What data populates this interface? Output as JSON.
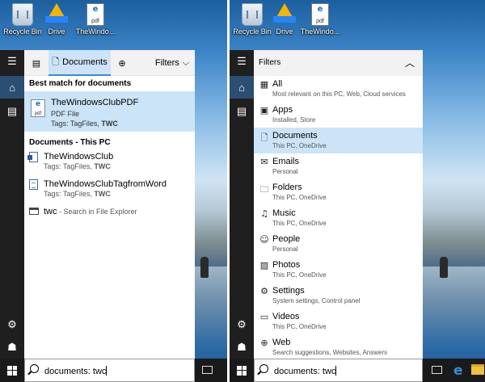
{
  "desktop": {
    "icons": [
      {
        "label": "Recycle Bin",
        "icon": "recycle-bin-icon"
      },
      {
        "label": "Drive",
        "icon": "google-drive-icon"
      },
      {
        "label": "TheWindo...",
        "icon": "pdf-file-icon",
        "glyph": "e",
        "tag": "pdf"
      }
    ]
  },
  "left": {
    "scopes": {
      "documents": "Documents",
      "filters": "Filters"
    },
    "best_match": {
      "heading": "Best match for documents",
      "title": "TheWindowsClubPDF",
      "type": "PDF File",
      "tags_prefix": "Tags: TagFiles, ",
      "tags_bold": "TWC",
      "icon_glyph": "e",
      "icon_tag": "pdf"
    },
    "documents_section": {
      "heading": "Documents - This PC",
      "items": [
        {
          "title": "TheWindowsClub",
          "tags_prefix": "Tags: TagFiles, ",
          "tags_bold": "TWC"
        },
        {
          "title": "TheWindowsClubTagfromWord",
          "tags_prefix": "Tags: TagFiles, ",
          "tags_bold": "TWC"
        }
      ]
    },
    "explorer_search": {
      "term": "twc",
      "suffix": " - Search in File Explorer"
    }
  },
  "right": {
    "filters_heading": "Filters",
    "filters": [
      {
        "title": "All",
        "sub": "Most relevant on this PC, Web, Cloud services",
        "icon": "grid-icon",
        "glyph": "▦"
      },
      {
        "title": "Apps",
        "sub": "Installed, Store",
        "icon": "apps-icon",
        "glyph": "▣"
      },
      {
        "title": "Documents",
        "sub": "This PC, OneDrive",
        "icon": "document-icon",
        "glyph": "🗋",
        "active": true
      },
      {
        "title": "Emails",
        "sub": "Personal",
        "icon": "mail-icon",
        "glyph": "✉"
      },
      {
        "title": "Folders",
        "sub": "This PC, OneDrive",
        "icon": "folder-icon",
        "glyph": "🗀"
      },
      {
        "title": "Music",
        "sub": "This PC, OneDrive",
        "icon": "music-icon",
        "glyph": "♫"
      },
      {
        "title": "People",
        "sub": "Personal",
        "icon": "people-icon",
        "glyph": "☺"
      },
      {
        "title": "Photos",
        "sub": "This PC, OneDrive",
        "icon": "photo-icon",
        "glyph": "▨"
      },
      {
        "title": "Settings",
        "sub": "System settings, Control panel",
        "icon": "gear-icon",
        "glyph": "⚙"
      },
      {
        "title": "Videos",
        "sub": "This PC, OneDrive",
        "icon": "video-icon",
        "glyph": "▭"
      },
      {
        "title": "Web",
        "sub": "Search suggestions, Websites, Answers",
        "icon": "globe-icon",
        "glyph": "⊕"
      }
    ]
  },
  "taskbar": {
    "search_query": "documents: twc"
  },
  "colors": {
    "accent": "#cce4f7",
    "rail": "#1f1f1f",
    "taskbar": "#1a1a1a"
  }
}
